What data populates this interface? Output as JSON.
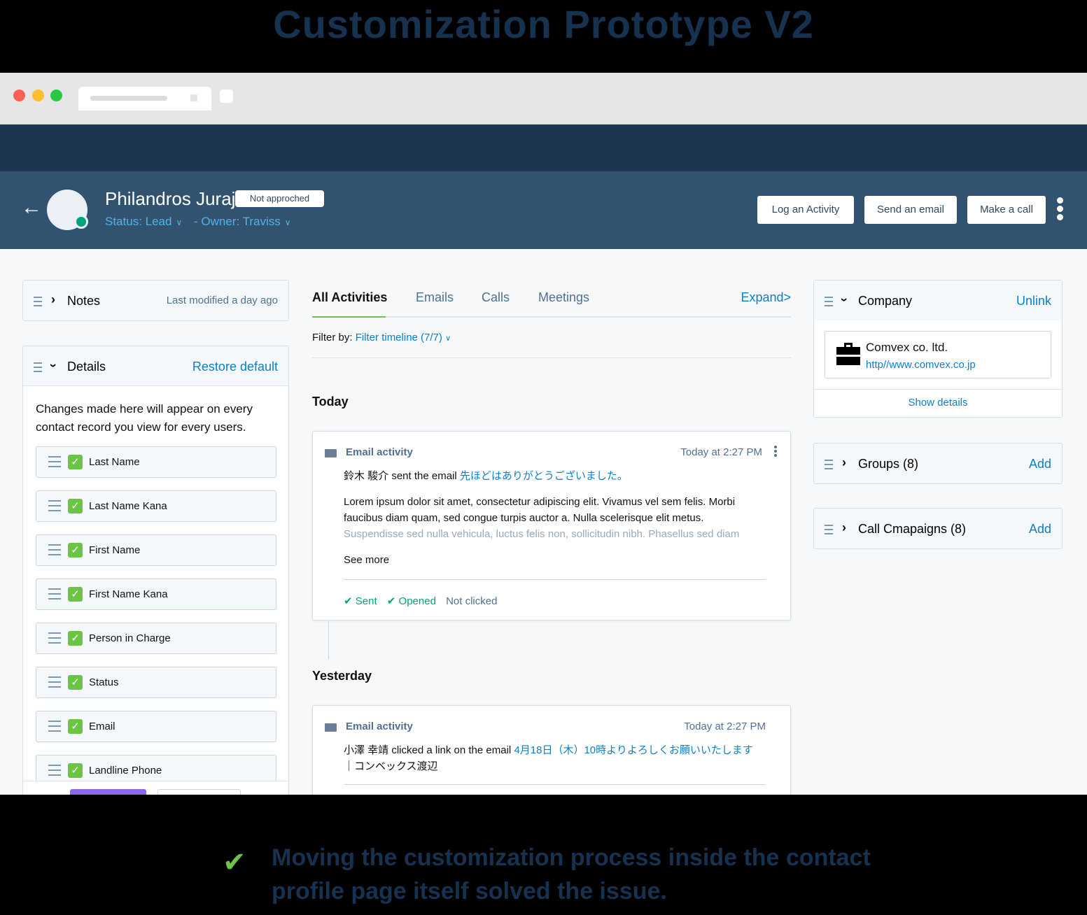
{
  "page_title": "Customization Prototype  V2",
  "header": {
    "contact_name": "Philandros Juraj",
    "badge": "Not approched",
    "status": "Status: Lead",
    "owner": "- Owner: Traviss",
    "actions": [
      "Log an Activity",
      "Send an email",
      "Make a call"
    ]
  },
  "notes": {
    "title": "Notes",
    "modified": "Last modified a day ago"
  },
  "details": {
    "title": "Details",
    "restore": "Restore default",
    "description": "Changes made here will appear on every contact record you view for every users.",
    "fields": [
      "Last Name",
      "Last Name Kana",
      "First Name",
      "First Name Kana",
      "Person in Charge",
      "Status",
      "Email",
      "Landline Phone"
    ]
  },
  "activities": {
    "tabs": [
      "All Activities",
      "Emails",
      "Calls",
      "Meetings"
    ],
    "expand": "Expand>",
    "filter_label": "Filter by:",
    "filter_value": "Filter timeline (7/7)",
    "today_label": "Today",
    "yesterday_label": "Yesterday",
    "card1": {
      "title": "Email activity",
      "time": "Today at 2:27 PM",
      "sender": "鈴木 駿介 sent the email",
      "subject": "先ほどはありがとうございました。",
      "body1": "Lorem ipsum dolor sit amet, consectetur adipiscing elit. Vivamus vel sem felis. Morbi",
      "body2": "faucibus diam quam, sed congue turpis auctor a. Nulla scelerisque elit metus.",
      "body3": "Suspendisse sed nulla vehicula, luctus felis non, sollicitudin nibh. Phasellus sed diam",
      "see_more": "See more",
      "sent": "Sent",
      "opened": "Opened",
      "clicked": "Not clicked"
    },
    "card2": {
      "title": "Email activity",
      "time": "Today at 2:27 PM",
      "sender": "小澤 幸靖 clicked a link on the email",
      "subject1": "4月18日（木）10時よりよろしくお願いいたします",
      "subject2": "｜コンベックス渡辺"
    }
  },
  "company": {
    "title": "Company",
    "unlink": "Unlink",
    "name": "Comvex co. ltd.",
    "url": "http//www.comvex.co.jp",
    "show_details": "Show details"
  },
  "groups": {
    "title": "Groups (8)",
    "add": "Add"
  },
  "campaigns": {
    "title": "Call Cmapaigns (8)",
    "add": "Add"
  },
  "footer_note": "Moving the customization process inside the contact profile page itself solved the issue.",
  "colors": {
    "header": "#32536f",
    "nav": "#1c3550",
    "link": "#0b7fc7",
    "check": "#6cc444"
  }
}
